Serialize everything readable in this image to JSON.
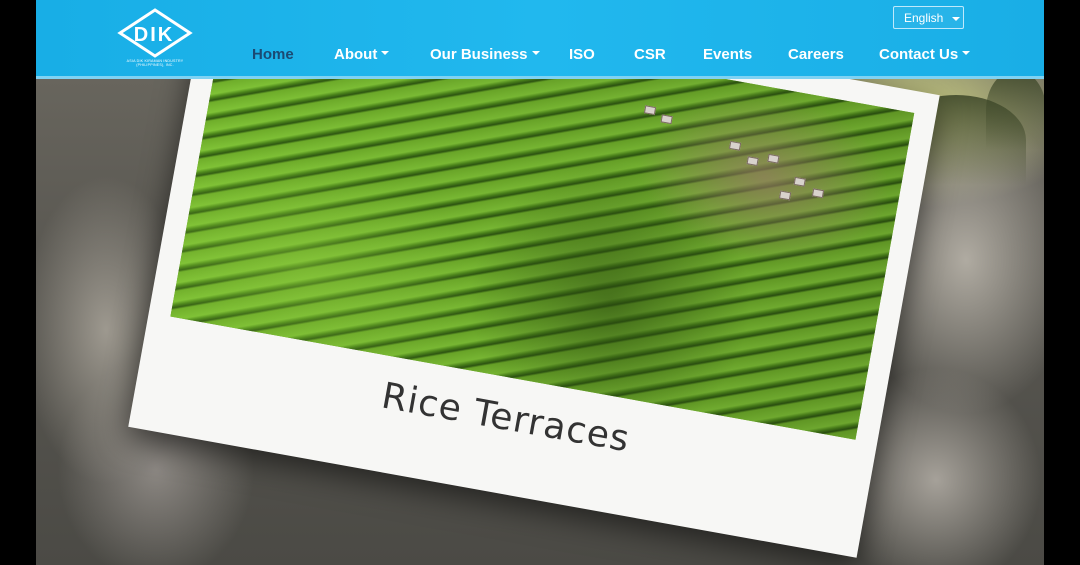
{
  "header": {
    "logo_text": "DIK",
    "logo_subtitle": "ASIA DIK KIRAMAN INDUSTRY (PHILIPPINES), INC.",
    "language": "English",
    "nav": [
      {
        "label": "Home",
        "active": true,
        "dropdown": false
      },
      {
        "label": "About",
        "active": false,
        "dropdown": true
      },
      {
        "label": "Our Business",
        "active": false,
        "dropdown": true
      },
      {
        "label": "ISO",
        "active": false,
        "dropdown": false
      },
      {
        "label": "CSR",
        "active": false,
        "dropdown": false
      },
      {
        "label": "Events",
        "active": false,
        "dropdown": false
      },
      {
        "label": "Careers",
        "active": false,
        "dropdown": false
      },
      {
        "label": "Contact Us",
        "active": false,
        "dropdown": true
      }
    ]
  },
  "hero": {
    "caption": "Rice Terraces"
  },
  "colors": {
    "header_bg": "#21b8ee",
    "nav_active": "#1b4a73",
    "nav_text": "#ffffff"
  },
  "icons": [
    "dik-diamond-logo-icon",
    "chevron-down-icon"
  ]
}
